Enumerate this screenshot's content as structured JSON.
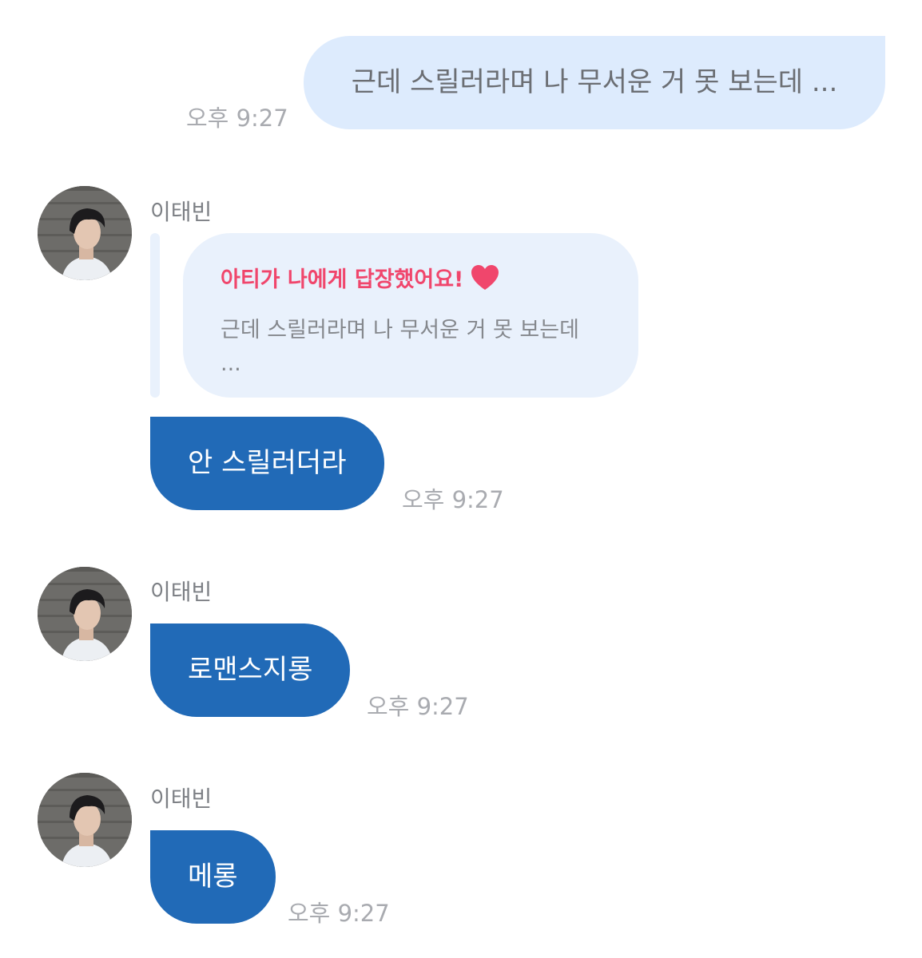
{
  "outgoing": {
    "text": "근데 스릴러라며 나 무서운 거 못 보는데 ...",
    "time": "오후 9:27"
  },
  "messages": [
    {
      "sender": "이태빈",
      "reply": {
        "title": "아티가 나에게 답장했어요!",
        "icon": "heart-icon",
        "quote": "근데 스릴러라며 나 무서운 거 못 보는데 ..."
      },
      "text": "안 스릴러더라",
      "time": "오후 9:27"
    },
    {
      "sender": "이태빈",
      "text": "로맨스지롱",
      "time": "오후 9:27"
    },
    {
      "sender": "이태빈",
      "text": "메롱",
      "time": "오후 9:27"
    }
  ],
  "colors": {
    "outgoing_bubble": "#ddebfd",
    "incoming_bubble": "#216ab7",
    "reply_card": "#e9f1fc",
    "reply_title": "#f0466c",
    "heart": "#f0466c",
    "timestamp": "#a9abb0"
  }
}
